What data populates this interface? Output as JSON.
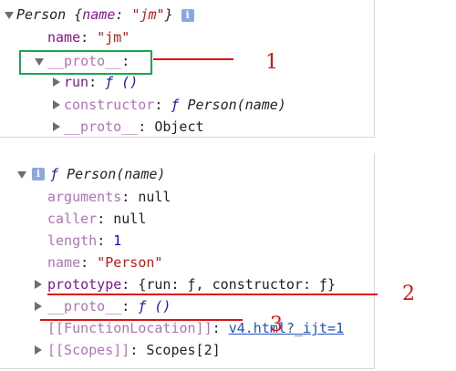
{
  "top_object": {
    "header_class": "Person",
    "header_open": "{",
    "header_key": "name",
    "header_colon": ": ",
    "header_value": "\"jm\"",
    "header_close": "}",
    "info_badge": "i",
    "name_key": "name",
    "name_value": "\"jm\"",
    "proto_key": "__proto__",
    "colon": ":",
    "proto_run_key": "run",
    "proto_run_value": "ƒ ()",
    "proto_ctor_key": "constructor",
    "proto_ctor_f": "ƒ",
    "proto_ctor_value": "Person(name)",
    "proto_proto_key": "__proto__",
    "proto_proto_value": "Object"
  },
  "function_object": {
    "header_f": "ƒ",
    "header_value": "Person(name)",
    "arguments_key": "arguments",
    "arguments_value": "null",
    "caller_key": "caller",
    "caller_value": "null",
    "length_key": "length",
    "length_value": "1",
    "name_key": "name",
    "name_value": "\"Person\"",
    "prototype_key": "prototype",
    "prototype_value": "{run: ƒ, constructor: ƒ}",
    "proto_key": "__proto__",
    "proto_value": "ƒ ()",
    "function_location_key": "[[FunctionLocation]]",
    "function_location_value": "v4.html?_ijt=1",
    "scopes_key": "[[Scopes]]",
    "scopes_value": "Scopes[2]"
  },
  "annotations": {
    "label_1": "1",
    "label_2": "2",
    "label_3": "3"
  },
  "colors": {
    "property_key": "#881391",
    "string_value": "#c41a16",
    "number_value": "#1c00cf",
    "highlight_box": "#1aa84e",
    "annotation_red": "#e01010"
  },
  "icons": {
    "expanded": "triangle-down-icon",
    "collapsed": "triangle-right-icon",
    "info": "info-icon"
  }
}
